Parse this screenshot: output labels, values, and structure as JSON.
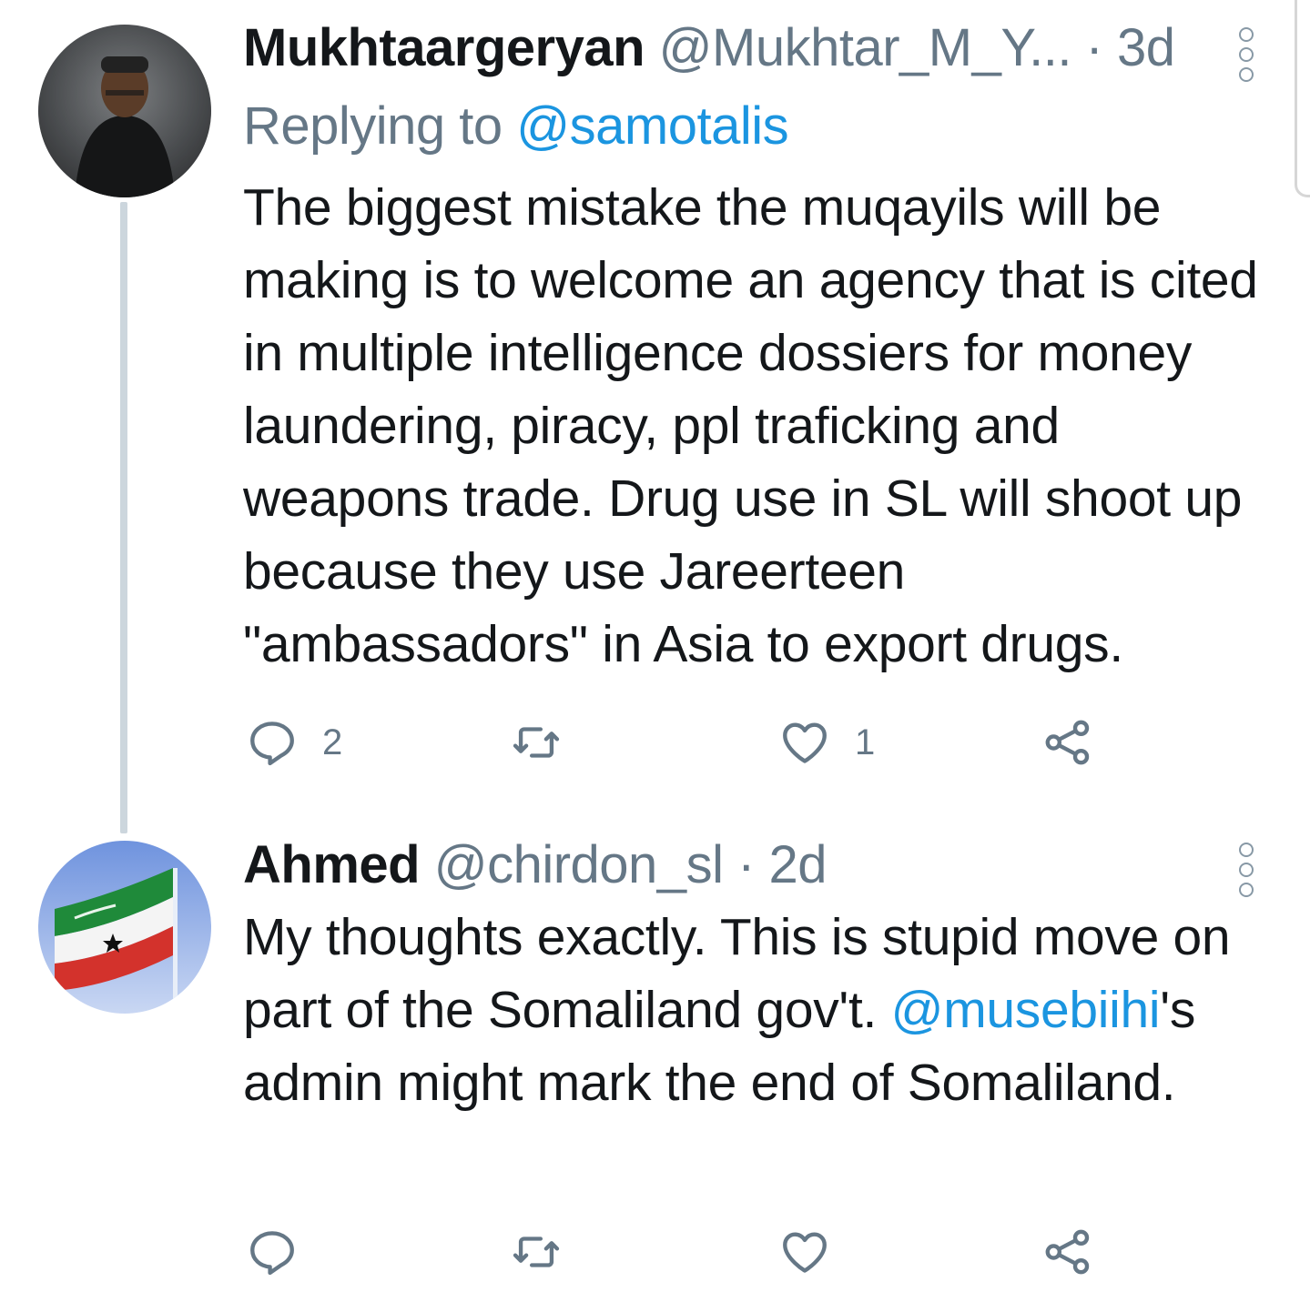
{
  "tweets": [
    {
      "name": "Mukhtaargeryan",
      "handle": "@Mukhtar_M_Y...",
      "separator": " · ",
      "time": "3d",
      "replying_prefix": "Replying to ",
      "replying_to": "@samotalis",
      "text": "The biggest mistake the muqayils will be making is to welcome an agency that is cited in multiple intelligence dossiers for money laundering, piracy, ppl traficking and weapons trade. Drug use in SL will shoot up because they use Jareerteen \"ambassadors\" in Asia to export drugs.",
      "reply_count": "2",
      "like_count": "1"
    },
    {
      "name": "Ahmed",
      "handle": "@chirdon_sl",
      "separator": " · ",
      "time": "2d",
      "text_before": "My thoughts exactly. This is stupid move on part of the Somaliland gov't. ",
      "mention": "@musebiihi",
      "text_after": "'s admin might mark the end of Somaliland."
    }
  ],
  "icons": {
    "reply": "reply-icon",
    "retweet": "retweet-icon",
    "like": "heart-icon",
    "share": "share-icon",
    "more": "more-icon"
  },
  "colors": {
    "text": "#14171a",
    "secondary": "#657786",
    "link": "#1b95e0",
    "thread_line": "#ccd6dd"
  }
}
